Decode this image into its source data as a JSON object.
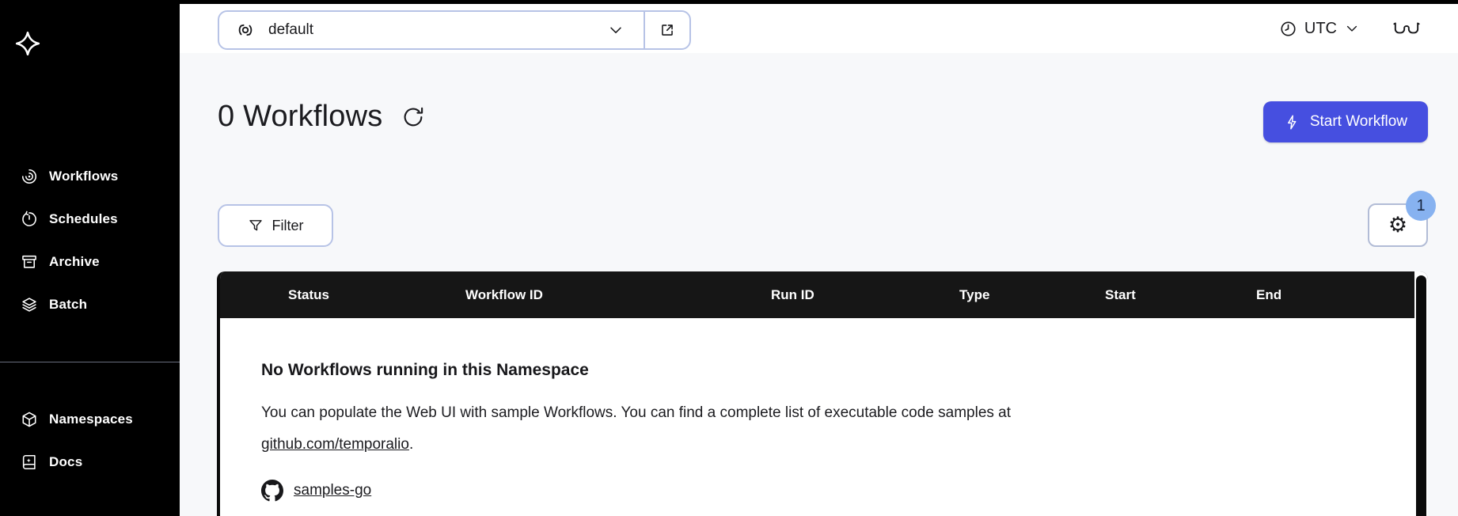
{
  "colors": {
    "accent": "#464fe0",
    "badge_bg": "#87b2f0",
    "selector_border": "#b7c3e6",
    "table_header_bg": "#161616",
    "page_bg": "#f7f8fa",
    "sidebar_bg": "#000000"
  },
  "topbar": {
    "namespace": {
      "value": "default"
    },
    "timezone": {
      "value": "UTC"
    }
  },
  "sidebar": {
    "nav_primary": [
      {
        "label": "Workflows",
        "icon": "workflows-icon"
      },
      {
        "label": "Schedules",
        "icon": "schedules-icon"
      },
      {
        "label": "Archive",
        "icon": "archive-icon"
      },
      {
        "label": "Batch",
        "icon": "batch-icon"
      }
    ],
    "nav_secondary": [
      {
        "label": "Namespaces",
        "icon": "namespaces-icon"
      },
      {
        "label": "Docs",
        "icon": "docs-icon"
      }
    ]
  },
  "main": {
    "title": "0 Workflows",
    "start_workflow_label": "Start Workflow",
    "filter_label": "Filter",
    "settings_badge": "1",
    "gear_glyph": "⚙",
    "table": {
      "columns": [
        "Status",
        "Workflow ID",
        "Run ID",
        "Type",
        "Start",
        "End"
      ]
    },
    "empty": {
      "heading": "No Workflows running in this Namespace",
      "line1": "You can populate the Web UI with sample Workflows. You can find a complete list of executable code samples at",
      "link": "github.com/temporalio",
      "after_link": ".",
      "sample_repo": "samples-go"
    }
  }
}
